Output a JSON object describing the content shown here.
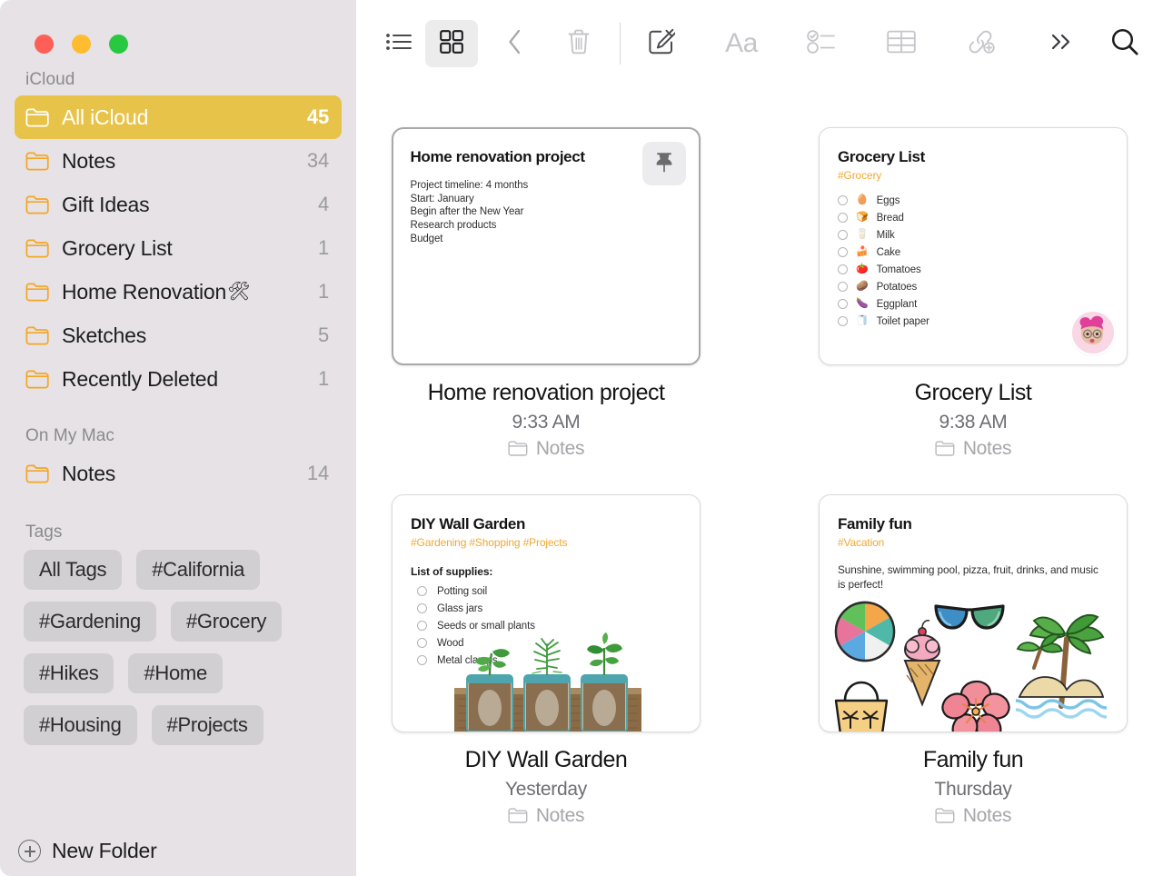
{
  "window": {
    "traffic_lights": [
      {
        "name": "close",
        "color": "#FF5F57"
      },
      {
        "name": "minimize",
        "color": "#FEBC2E"
      },
      {
        "name": "zoom",
        "color": "#28C840"
      }
    ]
  },
  "sidebar": {
    "sections": [
      {
        "header": "iCloud",
        "items": [
          {
            "label": "All iCloud",
            "emoji": "",
            "count": "45",
            "selected": true
          },
          {
            "label": "Notes",
            "emoji": "",
            "count": "34",
            "selected": false
          },
          {
            "label": "Gift Ideas",
            "emoji": "",
            "count": "4",
            "selected": false
          },
          {
            "label": "Grocery List",
            "emoji": "",
            "count": "1",
            "selected": false
          },
          {
            "label": "Home Renovation",
            "emoji": "🛠",
            "count": "1",
            "selected": false
          },
          {
            "label": "Sketches",
            "emoji": "",
            "count": "5",
            "selected": false
          },
          {
            "label": "Recently Deleted",
            "emoji": "",
            "count": "1",
            "selected": false
          }
        ]
      },
      {
        "header": "On My Mac",
        "items": [
          {
            "label": "Notes",
            "emoji": "",
            "count": "14",
            "selected": false
          }
        ]
      }
    ],
    "tags_header": "Tags",
    "tags": [
      "All Tags",
      "#California",
      "#Gardening",
      "#Grocery",
      "#Hikes",
      "#Home",
      "#Housing",
      "#Projects"
    ],
    "new_folder_label": "New Folder",
    "selected_color": "#E8C34A",
    "folder_icon_color": "#F5A623",
    "background": "#E6E2E6"
  },
  "toolbar": {
    "buttons": [
      {
        "name": "list-view-icon",
        "label": "List View",
        "active": false,
        "disabled": false
      },
      {
        "name": "gallery-view-icon",
        "label": "Gallery View",
        "active": true,
        "disabled": false
      },
      {
        "name": "back-icon",
        "label": "Back",
        "active": false,
        "disabled": true
      },
      {
        "name": "trash-icon",
        "label": "Delete",
        "active": false,
        "disabled": true
      },
      {
        "name": "compose-icon",
        "label": "New Note",
        "active": false,
        "disabled": false
      },
      {
        "name": "format-icon",
        "label": "Aa",
        "active": false,
        "disabled": true
      },
      {
        "name": "checklist-icon",
        "label": "Checklist",
        "active": false,
        "disabled": true
      },
      {
        "name": "table-icon",
        "label": "Table",
        "active": false,
        "disabled": true
      },
      {
        "name": "link-icon",
        "label": "Add Link",
        "active": false,
        "disabled": true
      },
      {
        "name": "more-icon",
        "label": "More",
        "active": false,
        "disabled": false
      },
      {
        "name": "search-icon",
        "label": "Search",
        "active": false,
        "disabled": false
      }
    ],
    "format_label": "Aa"
  },
  "gallery": {
    "notes": [
      {
        "title": "Home renovation project",
        "tags": "",
        "body_lines": [
          "Project timeline: 4 months",
          "Start: January",
          "Begin after the New Year",
          "Research products",
          "Budget"
        ],
        "checklist_heading": "",
        "checklist": [],
        "paragraph": "",
        "pinned": true,
        "selected": true,
        "has_memoji": false,
        "illustration": "none",
        "caption_title": "Home renovation project",
        "caption_date": "9:33 AM",
        "caption_folder": "Notes"
      },
      {
        "title": "Grocery List",
        "tags": "#Grocery",
        "body_lines": [],
        "checklist_heading": "",
        "checklist": [
          {
            "emoji": "🥚",
            "text": "Eggs"
          },
          {
            "emoji": "🍞",
            "text": "Bread"
          },
          {
            "emoji": "🥛",
            "text": "Milk"
          },
          {
            "emoji": "🍰",
            "text": "Cake"
          },
          {
            "emoji": "🍅",
            "text": "Tomatoes"
          },
          {
            "emoji": "🥔",
            "text": "Potatoes"
          },
          {
            "emoji": "🍆",
            "text": "Eggplant"
          },
          {
            "emoji": "🧻",
            "text": "Toilet paper"
          }
        ],
        "paragraph": "",
        "pinned": false,
        "selected": false,
        "has_memoji": true,
        "illustration": "none",
        "caption_title": "Grocery List",
        "caption_date": "9:38 AM",
        "caption_folder": "Notes"
      },
      {
        "title": "DIY Wall Garden",
        "tags": "#Gardening #Shopping #Projects",
        "body_lines": [],
        "checklist_heading": "List of supplies:",
        "checklist": [
          {
            "emoji": "",
            "text": "Potting soil"
          },
          {
            "emoji": "",
            "text": "Glass jars"
          },
          {
            "emoji": "",
            "text": "Seeds or small plants"
          },
          {
            "emoji": "",
            "text": "Wood"
          },
          {
            "emoji": "",
            "text": "Metal clamps"
          }
        ],
        "paragraph": "",
        "pinned": false,
        "selected": false,
        "has_memoji": false,
        "illustration": "plant-jars",
        "caption_title": "DIY Wall Garden",
        "caption_date": "Yesterday",
        "caption_folder": "Notes"
      },
      {
        "title": "Family fun",
        "tags": "#Vacation",
        "body_lines": [],
        "checklist_heading": "",
        "checklist": [],
        "paragraph": "Sunshine, swimming pool, pizza, fruit, drinks, and music is perfect!",
        "pinned": false,
        "selected": false,
        "has_memoji": false,
        "illustration": "beach-stickers",
        "caption_title": "Family fun",
        "caption_date": "Thursday",
        "caption_folder": "Notes"
      }
    ]
  },
  "colors": {
    "accent_tag": "#F0A830",
    "selected_folder": "#E8C34A",
    "sidebar_bg": "#E6E2E6",
    "main_bg": "#FFFFFF"
  }
}
